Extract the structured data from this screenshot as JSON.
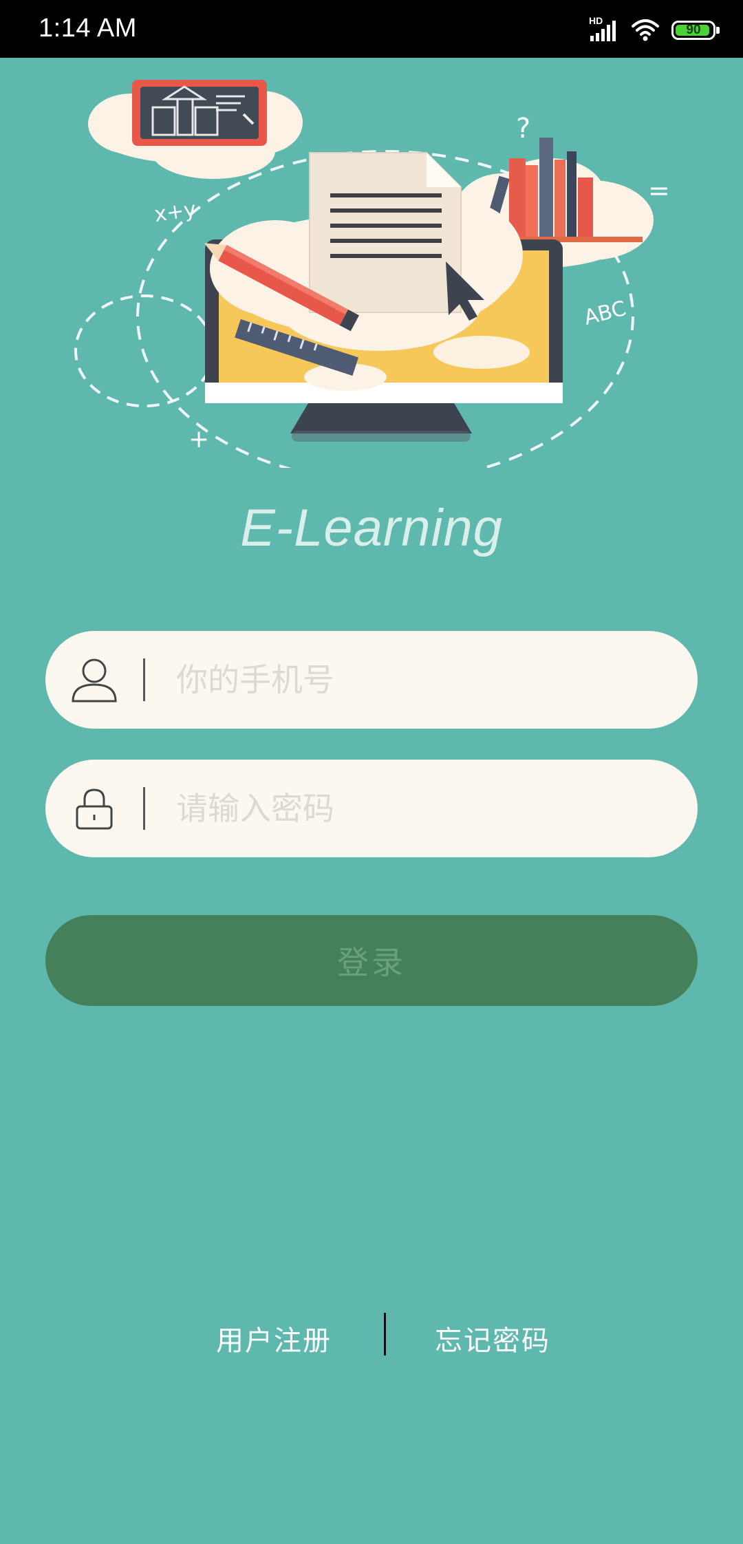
{
  "status_bar": {
    "time": "1:14 AM",
    "network_label": "HD",
    "battery_level": "90",
    "icons": [
      "signal-icon",
      "wifi-icon",
      "battery-icon"
    ]
  },
  "app": {
    "title": "E-Learning"
  },
  "illustration": {
    "doodles": [
      "x+y",
      "ABC",
      "?",
      "=",
      "+"
    ]
  },
  "login_form": {
    "phone_placeholder": "你的手机号",
    "password_placeholder": "请输入密码",
    "login_label": "登录"
  },
  "footer_links": {
    "register_label": "用户注册",
    "forgot_password_label": "忘记密码"
  },
  "colors": {
    "background": "#5fb8ae",
    "field_background": "#fcf7ef",
    "login_button": "#44805a",
    "login_text": "#6aa07e"
  }
}
